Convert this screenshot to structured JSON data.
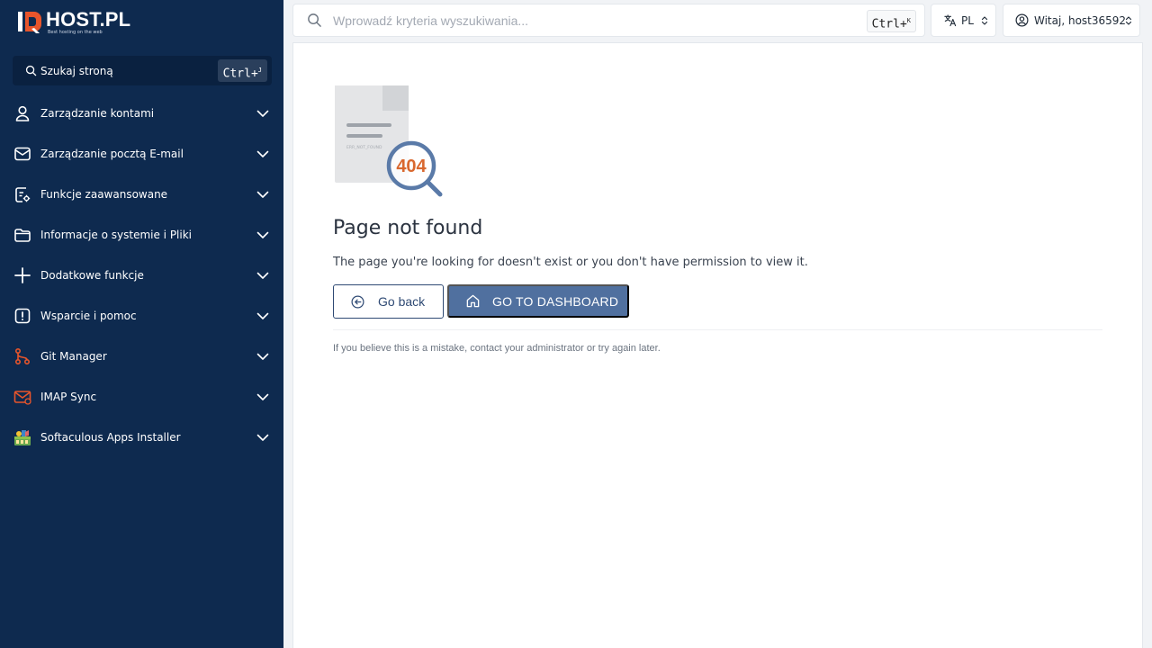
{
  "brand": {
    "name": "HOST.PL",
    "tagline": "Best hosting on the web"
  },
  "sidebar": {
    "search_label": "Szukaj stroną",
    "search_shortcut": "Ctrl+",
    "search_shortcut_key": "J",
    "items": [
      {
        "label": "Zarządzanie kontami",
        "icon": "user-icon"
      },
      {
        "label": "Zarządzanie pocztą E-mail",
        "icon": "mail-icon"
      },
      {
        "label": "Funkcje zaawansowane",
        "icon": "advanced-settings-icon"
      },
      {
        "label": "Informacje o systemie i Pliki",
        "icon": "folder-icon"
      },
      {
        "label": "Dodatkowe funkcje",
        "icon": "plus-icon"
      },
      {
        "label": "Wsparcie i pomoc",
        "icon": "alert-icon"
      },
      {
        "label": "Git Manager",
        "icon": "git-icon"
      },
      {
        "label": "IMAP Sync",
        "icon": "imap-sync-icon"
      },
      {
        "label": "Softaculous Apps Installer",
        "icon": "softaculous-icon"
      }
    ]
  },
  "header": {
    "search_placeholder": "Wprowadź kryteria wyszukiwania...",
    "search_shortcut": "Ctrl+",
    "search_shortcut_key": "K",
    "language": "PL",
    "user_greeting": "Witaj, host36592"
  },
  "error": {
    "code": "404",
    "doc_text": "ERR_NOT_FOUND",
    "title": "Page not found",
    "description": "The page you're looking for doesn't exist or you don't have permission to view it.",
    "back_label": "Go back",
    "dashboard_label": "GO TO DASHBOARD",
    "note": "If you believe this is a mistake, contact your administrator or try again later."
  },
  "colors": {
    "sidebar_bg": "#0e2a4f",
    "accent": "#e8552b",
    "primary_button": "#50709f",
    "error_code": "#d9682f",
    "magnifier": "#5a7aa8"
  }
}
